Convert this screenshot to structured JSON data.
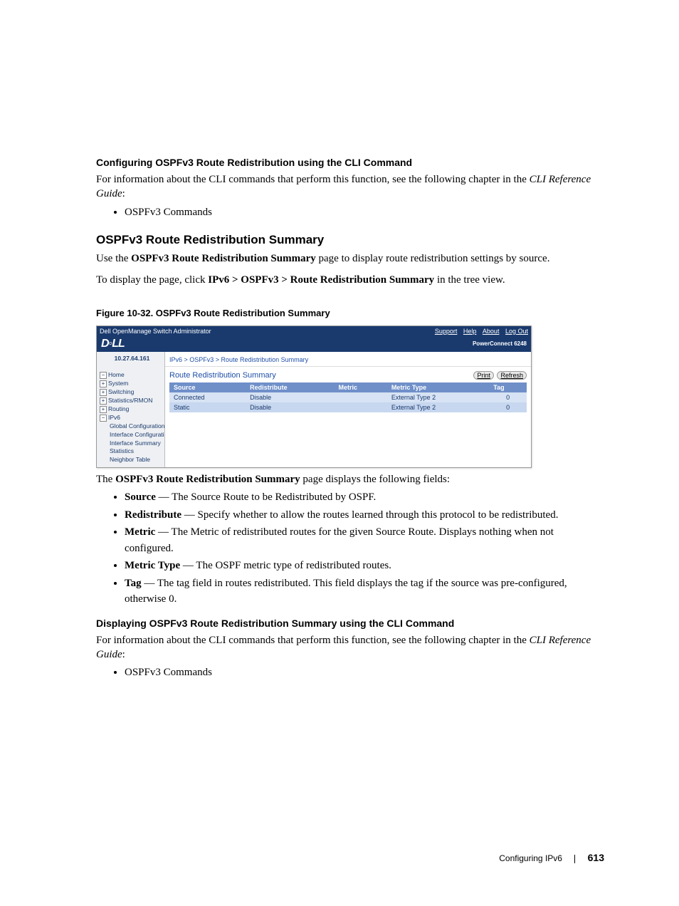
{
  "h1": "Configuring OSPFv3 Route Redistribution using the CLI Command",
  "p1a": "For information about the CLI commands that perform this function, see the following chapter in the ",
  "p1b": "CLI Reference Guide",
  "p1c": ":",
  "li1": "OSPFv3 Commands",
  "h2": "OSPFv3 Route Redistribution Summary",
  "p2a": "Use the ",
  "p2b": "OSPFv3 Route Redistribution Summary",
  "p2c": " page to display route redistribution settings by source.",
  "p3a": "To display the page, click ",
  "p3b": "IPv6 > OSPFv3 > Route Redistribution Summary",
  "p3c": " in the tree view.",
  "fig": "Figure 10-32.    OSPFv3 Route Redistribution Summary",
  "shot": {
    "title": "Dell OpenManage Switch Administrator",
    "links": {
      "support": "Support",
      "help": "Help",
      "about": "About",
      "logout": "Log Out"
    },
    "pc": "PowerConnect 6248",
    "ip": "10.27.64.161",
    "nav": {
      "home": "Home",
      "system": "System",
      "switching": "Switching",
      "stats": "Statistics/RMON",
      "routing": "Routing",
      "ipv6": "IPv6",
      "gc": "Global Configuration",
      "ic": "Interface Configuration",
      "is": "Interface Summary",
      "st": "Statistics",
      "nt": "Neighbor Table"
    },
    "crumb": "IPv6 > OSPFv3 > Route Redistribution Summary",
    "panel_title": "Route Redistribution Summary",
    "print": "Print",
    "refresh": "Refresh",
    "cols": {
      "source": "Source",
      "redis": "Redistribute",
      "metric": "Metric",
      "mtype": "Metric Type",
      "tag": "Tag"
    },
    "rows": [
      {
        "source": "Connected",
        "redis": "Disable",
        "metric": "",
        "mtype": "External Type 2",
        "tag": "0"
      },
      {
        "source": "Static",
        "redis": "Disable",
        "metric": "",
        "mtype": "External Type 2",
        "tag": "0"
      }
    ]
  },
  "p4a": "The ",
  "p4b": "OSPFv3 Route Redistribution Summary",
  "p4c": " page displays the following fields:",
  "fields": [
    {
      "t": "Source",
      "d": " — The Source Route to be Redistributed by OSPF."
    },
    {
      "t": "Redistribute",
      "d": " — Specify whether to allow the routes learned through this protocol to be redistributed."
    },
    {
      "t": "Metric",
      "d": " — The Metric of redistributed routes for the given Source Route. Displays nothing when not configured."
    },
    {
      "t": "Metric Type",
      "d": " — The OSPF metric type of redistributed routes."
    },
    {
      "t": "Tag",
      "d": " — The tag field in routes redistributed. This field displays the tag if the source was pre-configured, otherwise 0."
    }
  ],
  "h3": "Displaying OSPFv3 Route Redistribution Summary using the CLI Command",
  "p5a": "For information about the CLI commands that perform this function, see the following chapter in the ",
  "p5b": "CLI Reference Guide",
  "p5c": ":",
  "li2": "OSPFv3 Commands",
  "footer_section": "Configuring IPv6",
  "footer_page": "613"
}
